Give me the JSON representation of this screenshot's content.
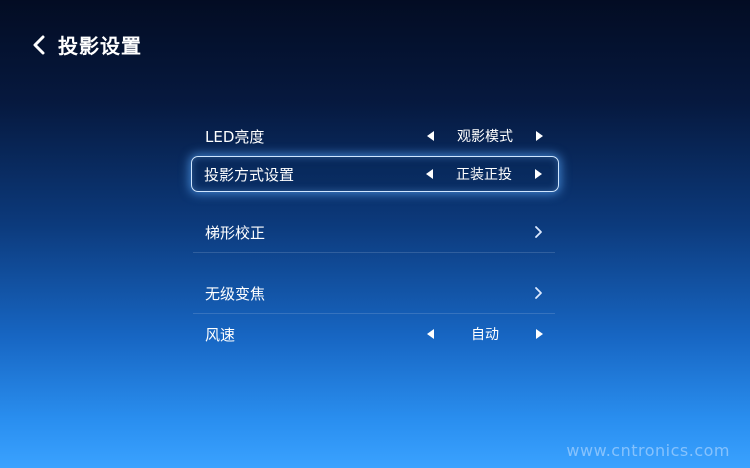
{
  "header": {
    "title": "投影设置"
  },
  "menu": {
    "items": [
      {
        "label": "LED亮度",
        "value": "观影模式"
      },
      {
        "label": "投影方式设置",
        "value": "正装正投"
      },
      {
        "label": "梯形校正"
      },
      {
        "label": "无级变焦"
      },
      {
        "label": "风速",
        "value": "自动"
      }
    ]
  },
  "watermark": "www.cntronics.com",
  "colors": {
    "selection_border": "#cfe6ff",
    "background_top": "#030c23",
    "background_bottom": "#3aa2ff"
  },
  "icons": {
    "back": "chevron-left-icon",
    "value_prev": "triangle-left-icon",
    "value_next": "triangle-right-icon",
    "submenu": "chevron-right-icon"
  }
}
